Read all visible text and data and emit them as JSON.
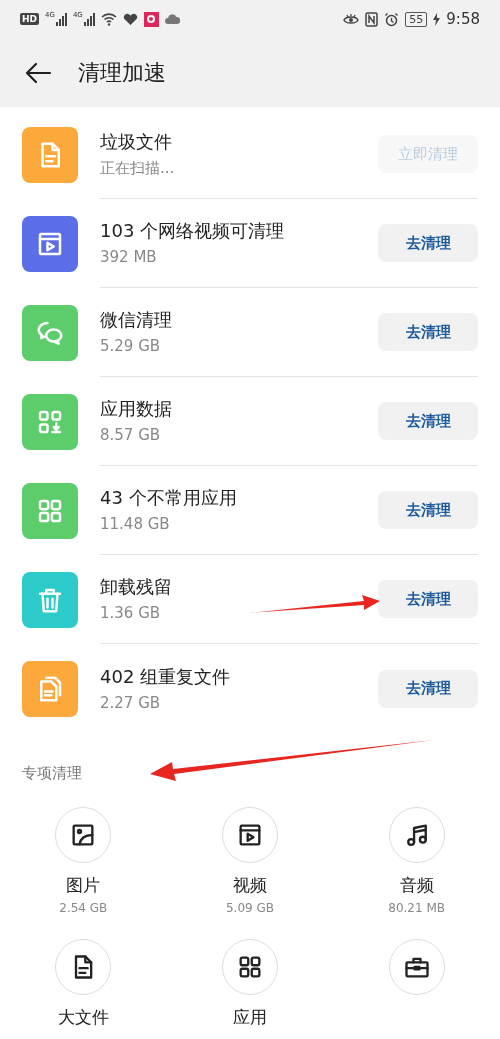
{
  "status_bar": {
    "hd": "HD",
    "networks": [
      "4G",
      "4G"
    ],
    "battery": "55",
    "time": "9:58"
  },
  "header": {
    "title": "清理加速"
  },
  "items": [
    {
      "kind": "document",
      "color": "#fca83a",
      "title": "垃圾文件",
      "subtitle": "正在扫描...",
      "button": "立即清理",
      "disabled": true
    },
    {
      "kind": "video",
      "color": "#5b6ee8",
      "title": "103 个网络视频可清理",
      "subtitle": "392 MB",
      "button": "去清理",
      "disabled": false
    },
    {
      "kind": "chat",
      "color": "#5ccd6a",
      "title": "微信清理",
      "subtitle": "5.29 GB",
      "button": "去清理",
      "disabled": false
    },
    {
      "kind": "app-data",
      "color": "#5ccd6a",
      "title": "应用数据",
      "subtitle": "8.57 GB",
      "button": "去清理",
      "disabled": false
    },
    {
      "kind": "apps",
      "color": "#5ccd6a",
      "title": "43 个不常用应用",
      "subtitle": "11.48 GB",
      "button": "去清理",
      "disabled": false
    },
    {
      "kind": "trash",
      "color": "#2ccbc9",
      "title": "卸载残留",
      "subtitle": "1.36 GB",
      "button": "去清理",
      "disabled": false
    },
    {
      "kind": "files",
      "color": "#fca83a",
      "title": "402 组重复文件",
      "subtitle": "2.27 GB",
      "button": "去清理",
      "disabled": false
    }
  ],
  "special": {
    "title": "专项清理",
    "items": [
      {
        "kind": "image",
        "label": "图片",
        "size": "2.54 GB"
      },
      {
        "kind": "video",
        "label": "视频",
        "size": "5.09 GB"
      },
      {
        "kind": "music",
        "label": "音频",
        "size": "80.21 MB"
      },
      {
        "kind": "document",
        "label": "大文件"
      },
      {
        "kind": "apps",
        "label": "应用"
      },
      {
        "kind": "briefcase"
      }
    ]
  }
}
